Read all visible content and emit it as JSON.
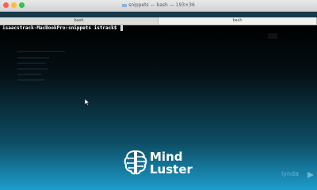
{
  "window": {
    "title": "snippets — bash — 193×36",
    "folder_icon": "folder-icon"
  },
  "tabs": [
    {
      "label": "bash",
      "active": false
    },
    {
      "label": "bash",
      "active": true
    }
  ],
  "terminal": {
    "prompt": "isaacstrack-MacBookPro:snippets istrack$ "
  },
  "watermark": {
    "logo_line1": "Mind",
    "logo_line2": "Luster",
    "logo_icon": "brain-circuit-icon"
  },
  "corner_badge": {
    "text": "lynda"
  },
  "colors": {
    "terminal_top": "#000000",
    "terminal_bottom": "#1d9dcc",
    "prompt_text": "#ffffff"
  }
}
